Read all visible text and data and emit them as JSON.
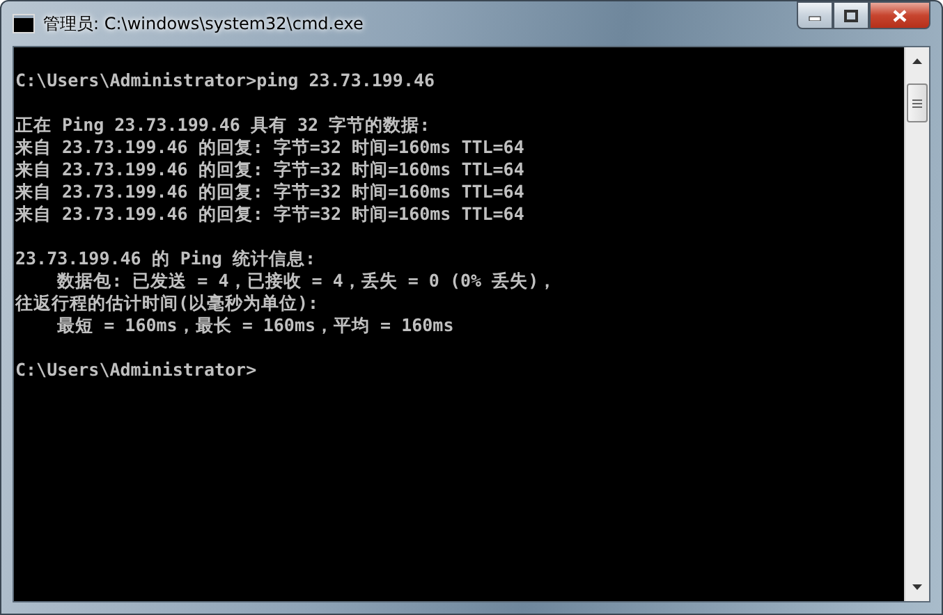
{
  "window": {
    "title": "管理员: C:\\windows\\system32\\cmd.exe"
  },
  "console": {
    "blocks": [
      [
        "C:\\Users\\Administrator>ping 23.73.199.46"
      ],
      [
        "正在 Ping 23.73.199.46 具有 32 字节的数据:",
        "来自 23.73.199.46 的回复: 字节=32 时间=160ms TTL=64",
        "来自 23.73.199.46 的回复: 字节=32 时间=160ms TTL=64",
        "来自 23.73.199.46 的回复: 字节=32 时间=160ms TTL=64",
        "来自 23.73.199.46 的回复: 字节=32 时间=160ms TTL=64"
      ],
      [
        "23.73.199.46 的 Ping 统计信息:",
        "    数据包: 已发送 = 4，已接收 = 4，丢失 = 0 (0% 丢失)，",
        "往返行程的估计时间(以毫秒为单位):",
        "    最短 = 160ms，最长 = 160ms，平均 = 160ms"
      ],
      [
        "C:\\Users\\Administrator>"
      ]
    ]
  }
}
